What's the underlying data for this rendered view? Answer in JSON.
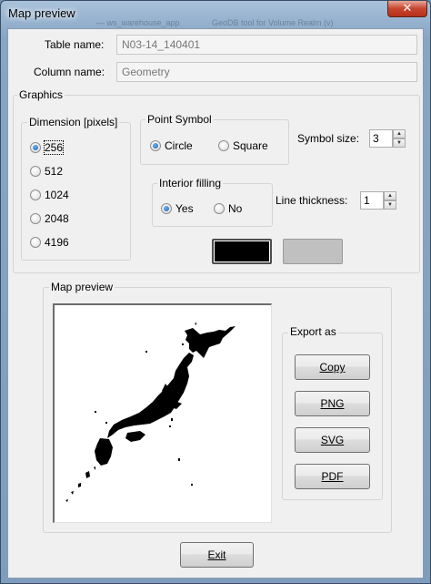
{
  "window": {
    "title": "Map preview",
    "close_glyph": "✕",
    "background_ghost_text_1": "— ws_warehouse_app",
    "background_ghost_text_2": "GeoDB tool for Volume Realm (v)"
  },
  "fields": {
    "table_label": "Table name:",
    "table_value": "N03-14_140401",
    "column_label": "Column name:",
    "column_value": "Geometry"
  },
  "graphics": {
    "title": "Graphics",
    "dimension": {
      "title": "Dimension [pixels]",
      "options": [
        "256",
        "512",
        "1024",
        "2048",
        "4196"
      ],
      "selected": "256"
    },
    "point_symbol": {
      "title": "Point Symbol",
      "options": [
        "Circle",
        "Square"
      ],
      "selected": "Circle"
    },
    "symbol_size": {
      "label": "Symbol size:",
      "value": "3"
    },
    "interior_filling": {
      "title": "Interior filling",
      "options": [
        "Yes",
        "No"
      ],
      "selected": "Yes"
    },
    "line_thickness": {
      "label": "Line thickness:",
      "value": "1"
    },
    "colors": {
      "line": "#000000",
      "fill": "#c0c0c0",
      "accent": "#1b5fa8"
    }
  },
  "preview": {
    "title": "Map preview",
    "export": {
      "title": "Export as",
      "buttons": [
        "Copy",
        "PNG",
        "SVG",
        "PDF"
      ]
    }
  },
  "footer": {
    "exit_label": "Exit"
  }
}
